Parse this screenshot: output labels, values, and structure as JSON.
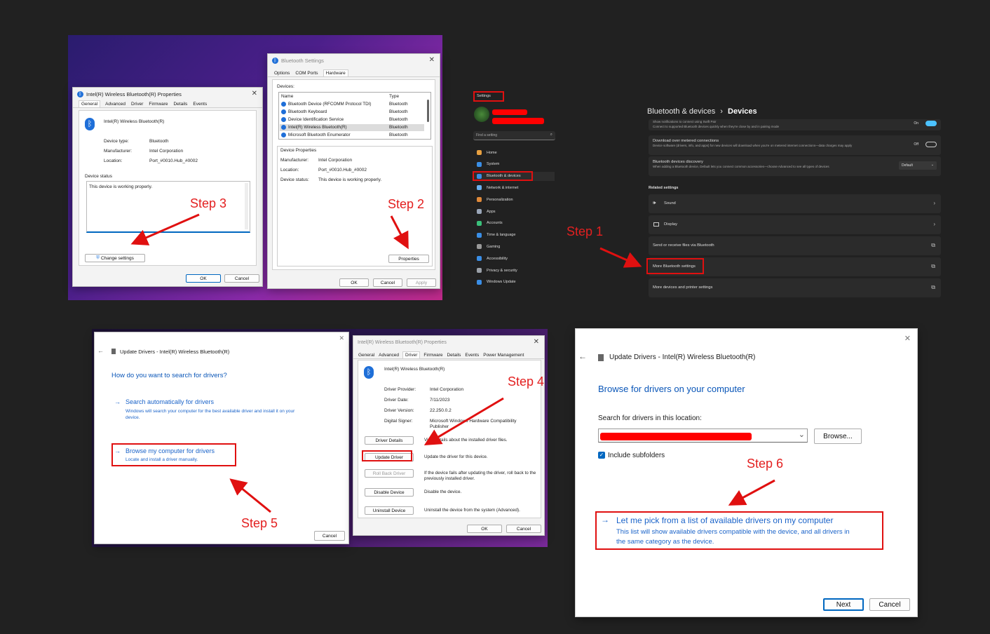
{
  "steps": {
    "step1": "Step 1",
    "step2": "Step 2",
    "step3": "Step 3",
    "step4": "Step 4",
    "step5": "Step 5",
    "step6": "Step 6"
  },
  "props1": {
    "title": "Intel(R) Wireless Bluetooth(R) Properties",
    "tabs": [
      "General",
      "Advanced",
      "Driver",
      "Firmware",
      "Details",
      "Events"
    ],
    "device_name": "Intel(R) Wireless Bluetooth(R)",
    "rows": [
      {
        "k": "Device type:",
        "v": "Bluetooth"
      },
      {
        "k": "Manufacturer:",
        "v": "Intel Corporation"
      },
      {
        "k": "Location:",
        "v": "Port_#0010.Hub_#0002"
      }
    ],
    "status_label": "Device status",
    "status_text": "This device is working properly.",
    "change_settings": "Change settings",
    "ok": "OK",
    "cancel": "Cancel"
  },
  "btsettings": {
    "title": "Bluetooth Settings",
    "tabs": [
      "Options",
      "COM Ports",
      "Hardware"
    ],
    "devices_label": "Devices:",
    "col_name": "Name",
    "col_type": "Type",
    "devices": [
      {
        "name": "Bluetooth Device (RFCOMM Protocol TDI)",
        "type": "Bluetooth"
      },
      {
        "name": "Bluetooth Keyboard",
        "type": "Bluetooth"
      },
      {
        "name": "Device Identification Service",
        "type": "Bluetooth"
      },
      {
        "name": "Intel(R) Wireless Bluetooth(R)",
        "type": "Bluetooth"
      },
      {
        "name": "Microsoft Bluetooth Enumerator",
        "type": "Bluetooth"
      }
    ],
    "props_label": "Device Properties",
    "props": [
      {
        "k": "Manufacturer:",
        "v": "Intel Corporation"
      },
      {
        "k": "Location:",
        "v": "Port_#0010.Hub_#0002"
      },
      {
        "k": "Device status:",
        "v": "This device is working properly."
      }
    ],
    "properties_btn": "Properties",
    "ok": "OK",
    "cancel": "Cancel",
    "apply": "Apply"
  },
  "settings": {
    "title": "Settings",
    "search_placeholder": "Find a setting",
    "nav": [
      "Home",
      "System",
      "Bluetooth & devices",
      "Network & internet",
      "Personalization",
      "Apps",
      "Accounts",
      "Time & language",
      "Gaming",
      "Accessibility",
      "Privacy & security",
      "Windows Update"
    ],
    "breadcrumb_parent": "Bluetooth & devices",
    "breadcrumb_sep": "›",
    "breadcrumb_current": "Devices",
    "rows_top": [
      {
        "t": "Show notifications to connect using Swift Pair",
        "s": "Connect to supported Bluetooth devices quickly when they're close by and in pairing mode",
        "v": "On"
      },
      {
        "t": "Download over metered connections",
        "s": "Device software (drivers, info, and apps) for new devices will download when you're on metered internet connections—data charges may apply",
        "v": "Off"
      },
      {
        "t": "Bluetooth devices discovery",
        "s": "When adding a Bluetooth device, Default lets you connect common accessories—choose Advanced to see all types of devices",
        "v": "Default"
      }
    ],
    "related": "Related settings",
    "related_rows": [
      "Sound",
      "Display",
      "Send or receive files via Bluetooth",
      "More Bluetooth settings",
      "More devices and printer settings"
    ]
  },
  "update1": {
    "title": "Update Drivers - Intel(R) Wireless Bluetooth(R)",
    "heading": "How do you want to search for drivers?",
    "opt1_title": "Search automatically for drivers",
    "opt1_desc": "Windows will search your computer for the best available driver and install it on your device.",
    "opt2_title": "Browse my computer for drivers",
    "opt2_desc": "Locate and install a driver manually.",
    "cancel": "Cancel"
  },
  "props2": {
    "title": "Intel(R) Wireless Bluetooth(R) Properties",
    "tabs": [
      "General",
      "Advanced",
      "Driver",
      "Firmware",
      "Details",
      "Events",
      "Power Management"
    ],
    "device_name": "Intel(R) Wireless Bluetooth(R)",
    "rows": [
      {
        "k": "Driver Provider:",
        "v": "Intel Corporation"
      },
      {
        "k": "Driver Date:",
        "v": "7/11/2023"
      },
      {
        "k": "Driver Version:",
        "v": "22.250.0.2"
      },
      {
        "k": "Digital Signer:",
        "v": "Microsoft Windows Hardware Compatibility Publisher"
      }
    ],
    "buttons": [
      {
        "b": "Driver Details",
        "d": "View details about the installed driver files."
      },
      {
        "b": "Update Driver",
        "d": "Update the driver for this device."
      },
      {
        "b": "Roll Back Driver",
        "d": "If the device fails after updating the driver, roll back to the previously installed driver."
      },
      {
        "b": "Disable Device",
        "d": "Disable the device."
      },
      {
        "b": "Uninstall Device",
        "d": "Uninstall the device from the system (Advanced)."
      }
    ],
    "ok": "OK",
    "cancel": "Cancel"
  },
  "update2": {
    "title": "Update Drivers - Intel(R) Wireless Bluetooth(R)",
    "heading": "Browse for drivers on your computer",
    "search_label": "Search for drivers in this location:",
    "browse": "Browse...",
    "include_sub": "Include subfolders",
    "pick_title": "Let me pick from a list of available drivers on my computer",
    "pick_desc1": "This list will show available drivers compatible with the device, and all drivers in",
    "pick_desc2": "the same category as the device.",
    "next": "Next",
    "cancel": "Cancel"
  },
  "colors": {
    "accent": "#0067c0",
    "highlight": "#e01010",
    "background": "#212121"
  }
}
